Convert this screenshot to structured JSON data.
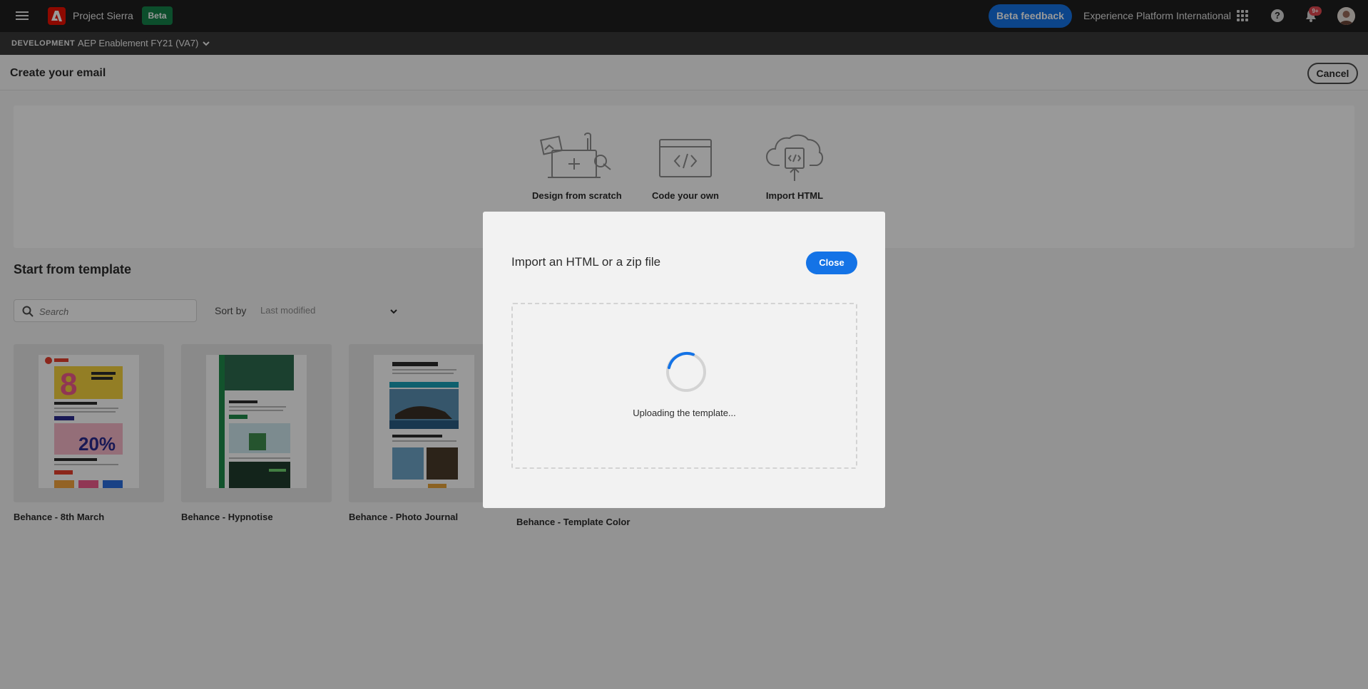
{
  "topbar": {
    "app_name": "Project Sierra",
    "beta_label": "Beta",
    "feedback_label": "Beta feedback",
    "org_name": "Experience Platform International",
    "notification_count": "9+"
  },
  "sandbox": {
    "environment": "DEVELOPMENT",
    "name": "AEP Enablement FY21 (VA7)"
  },
  "page": {
    "title": "Create your email",
    "cancel_label": "Cancel"
  },
  "create_options": [
    {
      "label": "Design from scratch"
    },
    {
      "label": "Code your own"
    },
    {
      "label": "Import HTML"
    }
  ],
  "templates": {
    "section_title": "Start from template",
    "search_placeholder": "Search",
    "sort_label": "Sort by",
    "sort_value": "Last modified",
    "items": [
      {
        "name": "Behance - 8th March"
      },
      {
        "name": "Behance - Hypnotise"
      },
      {
        "name": "Behance - Photo Journal"
      },
      {
        "name": "Behance - Template Color"
      }
    ]
  },
  "dialog": {
    "title": "Import an HTML or a zip file",
    "close_label": "Close",
    "status_text": "Uploading the template..."
  },
  "colors": {
    "accent": "#1473e6",
    "beta_badge": "#15824a",
    "adobe_red": "#eb1000",
    "topbar": "#1e1e1e"
  }
}
